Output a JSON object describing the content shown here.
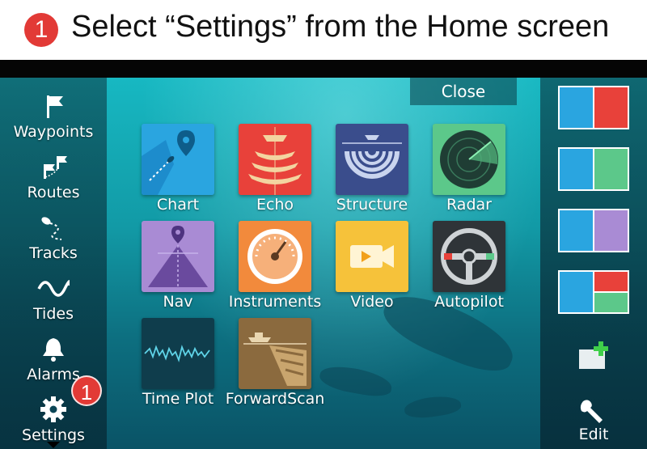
{
  "banner": {
    "step_number": "1",
    "instruction": "Select “Settings” from the Home screen"
  },
  "sidebar": {
    "items": [
      {
        "label": "Waypoints",
        "icon": "waypoint-flag-icon"
      },
      {
        "label": "Routes",
        "icon": "routes-flags-icon"
      },
      {
        "label": "Tracks",
        "icon": "tracks-icon"
      },
      {
        "label": "Tides",
        "icon": "tides-wave-icon"
      },
      {
        "label": "Alarms",
        "icon": "alarm-bell-icon"
      },
      {
        "label": "Settings",
        "icon": "gear-icon"
      }
    ],
    "callout_number": "1"
  },
  "close_label": "Close",
  "apps": [
    {
      "label": "Chart",
      "color": "#2aa5e0"
    },
    {
      "label": "Echo",
      "color": "#e8413a"
    },
    {
      "label": "Structure",
      "color": "#3a4d8c"
    },
    {
      "label": "Radar",
      "color": "#5cc88a"
    },
    {
      "label": "Nav",
      "color": "#a98bd4"
    },
    {
      "label": "Instruments",
      "color": "#f28a3c"
    },
    {
      "label": "Video",
      "color": "#f6c23a"
    },
    {
      "label": "Autopilot",
      "color": "#2f3438"
    },
    {
      "label": "Time Plot",
      "color": "#0f3d4c"
    },
    {
      "label": "ForwardScan",
      "color": "#8b6a3e"
    }
  ],
  "right_panel": {
    "edit_label": "Edit",
    "add_icon": "add-page-icon",
    "edit_icon": "wrench-icon"
  }
}
